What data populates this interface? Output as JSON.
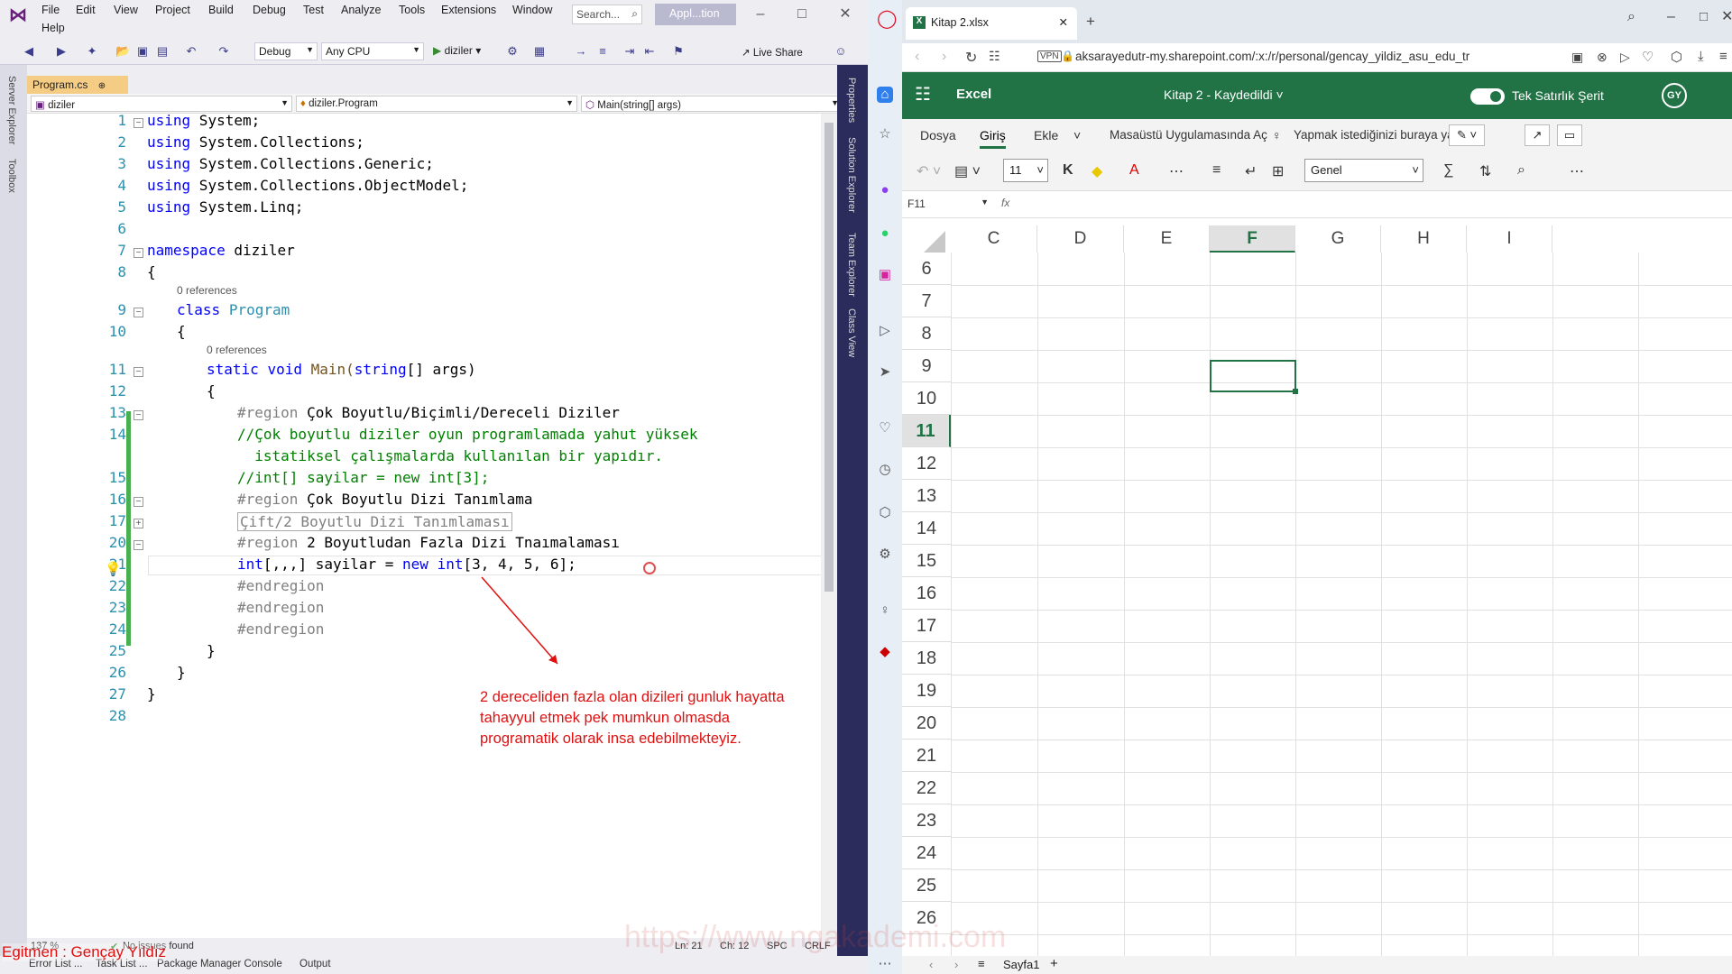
{
  "vs": {
    "menu": [
      "File",
      "Edit",
      "View",
      "Project",
      "Build",
      "Debug",
      "Test",
      "Analyze",
      "Tools",
      "Extensions",
      "Window",
      "Help"
    ],
    "search_placeholder": "Search...",
    "app_label": "Appl...tion",
    "toolbar": {
      "config": "Debug",
      "platform": "Any CPU",
      "run_label": "diziler",
      "live_share": "Live Share"
    },
    "left_tabs": [
      "Server Explorer",
      "Toolbox"
    ],
    "right_tabs": [
      "Properties",
      "Solution Explorer",
      "Team Explorer",
      "Class View"
    ],
    "doc_tab": "Program.cs",
    "nav": {
      "project": "diziler",
      "class": "diziler.Program",
      "member": "Main(string[] args)"
    },
    "refs_label": "0 references",
    "line_numbers": [
      "1",
      "2",
      "3",
      "4",
      "5",
      "6",
      "7",
      "8",
      "9",
      "10",
      "11",
      "12",
      "13",
      "14",
      "",
      "15",
      "16",
      "17",
      "20",
      "21",
      "22",
      "23",
      "24",
      "25",
      "26",
      "27",
      "28"
    ],
    "code": {
      "l1": {
        "kw": "using",
        "rest": " System;"
      },
      "l2": {
        "kw": "using",
        "rest": " System.Collections;"
      },
      "l3": {
        "kw": "using",
        "rest": " System.Collections.Generic;"
      },
      "l4": {
        "kw": "using",
        "rest": " System.Collections.ObjectModel;"
      },
      "l5": {
        "kw": "using",
        "rest": " System.Linq;"
      },
      "l7": {
        "kw": "namespace",
        "rest": " diziler"
      },
      "l8": "{",
      "l9": {
        "kw": "class",
        "cls": "Program"
      },
      "l10": "{",
      "l11": {
        "kw1": "static",
        "kw2": "void",
        "name": "Main(",
        "kw3": "string",
        "rest": "[] args)"
      },
      "l12": "{",
      "l13": {
        "pp": "#region",
        "rest": " Çok Boyutlu/Biçimli/Dereceli Diziler"
      },
      "l14": "//Çok boyutlu diziler oyun programlamada yahut yüksek",
      "l14b": "  istatiksel çalışmalarda kullanılan bir yapıdır.",
      "l15": "//int[] sayilar = new int[3];",
      "l16": {
        "pp": "#region",
        "rest": " Çok Boyutlu Dizi Tanımlama"
      },
      "l17": "Çift/2 Boyutlu Dizi Tanımlaması",
      "l20": {
        "pp": "#region",
        "rest": " 2 Boyutludan Fazla Dizi Tnaımalaması"
      },
      "l21": {
        "kw": "int",
        "mid": "[,,,] sayilar = ",
        "kw2": "new",
        "sp": " ",
        "kw3": "int",
        "rest": "[3, 4, 5, 6];"
      },
      "l22": "#endregion",
      "l23": "#endregion",
      "l24": "#endregion",
      "l25": "}",
      "l26": "}",
      "l27": "}"
    },
    "caption": [
      "2 dereceliden fazla olan dizileri gunluk hayatta",
      "tahayyul etmek pek mumkun olmasda",
      "programatik olarak insa edebilmekteyiz."
    ],
    "status": {
      "zoom": "137 %",
      "issues": "No issues found",
      "ln": "Ln: 21",
      "ch": "Ch: 12",
      "spc": "SPC",
      "crlf": "CRLF"
    },
    "bottom_tabs": [
      "Error List ...",
      "Task List ...",
      "Package Manager Console",
      "Output"
    ],
    "instructor": "Egitmen : Gençay Yıldız",
    "watermark": "https://www.ngakademi.com"
  },
  "browser": {
    "tab_title": "Kitap 2.xlsx",
    "url": "aksarayedutr-my.sharepoint.com/:x:/r/personal/gencay_yildiz_asu_edu_tr",
    "vpn": "VPN",
    "excel": {
      "app": "Excel",
      "doc_title": "Kitap 2 - Kaydedildi",
      "single_line_ribbon": "Tek Satırlık Şerit",
      "user_initials": "GY",
      "tabs": [
        "Dosya",
        "Giriş",
        "Ekle"
      ],
      "open_desktop": "Masaüstü Uygulamasında Aç",
      "tell_me": "Yapmak istediğinizi buraya ya",
      "font_size": "11",
      "bold": "K",
      "number_format": "Genel",
      "name_box": "F11",
      "fx": "fx",
      "columns": [
        "C",
        "D",
        "E",
        "F",
        "G",
        "H",
        "I"
      ],
      "rows": [
        "6",
        "7",
        "8",
        "9",
        "10",
        "11",
        "12",
        "13",
        "14",
        "15",
        "16",
        "17",
        "18",
        "19",
        "20",
        "21",
        "22",
        "23",
        "24",
        "25",
        "26"
      ],
      "selected_cell": "F11",
      "sheet": "Sayfa1"
    }
  }
}
